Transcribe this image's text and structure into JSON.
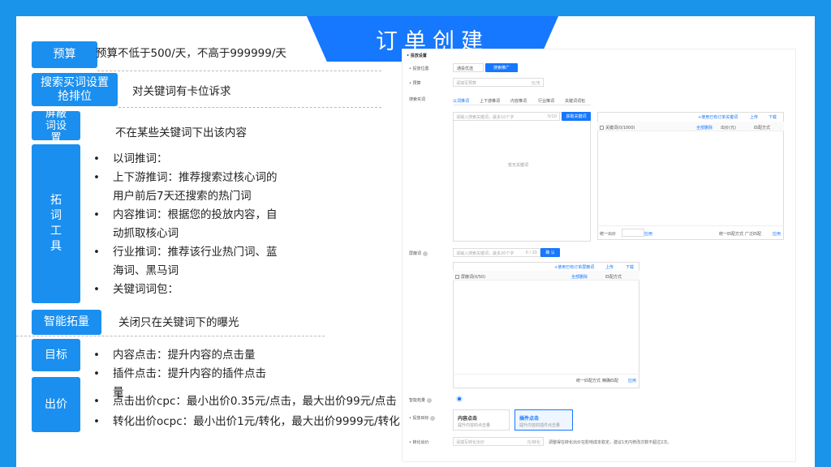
{
  "title": "订单创建",
  "rows": {
    "budget": {
      "label": "预算",
      "desc": "预算不低于500/天，不高于999999/天"
    },
    "bid_rank": {
      "label": "搜索买词设置抢排位",
      "desc": "对关键词有卡位诉求"
    },
    "block": {
      "label": "屏蔽词设置",
      "desc": "不在某些关键词下出该内容"
    },
    "expand_tool": {
      "label": "拓词工具",
      "items": [
        "以词推词：",
        "上下游推词：推荐搜索过核心词的用户前后7天还搜索的热门词",
        "内容推词：根据您的投放内容，自动抓取核心词",
        "行业推词：推荐该行业热门词、蓝海词、黑马词",
        "关键词词包："
      ]
    },
    "smart": {
      "label": "智能拓量",
      "desc": "关闭只在关键词下的曝光"
    },
    "target": {
      "label": "目标",
      "items": [
        "内容点击：提升内容的点击量",
        "插件点击：提升内容的插件点击量"
      ]
    },
    "bid": {
      "label": "出价",
      "items": [
        "点击出价cpc：最小出价0.35元/点击，最大出价99元/点击",
        "转化出价ocpc：最小出价1元/转化，最大出价9999元/转化"
      ]
    }
  },
  "screenshot": {
    "section_title": "• 投放设置",
    "placement_label": "• 投放位置",
    "placement_opt1": "通投优选",
    "placement_opt2": "搜索推广",
    "budget_label": "• 预算",
    "budget_placeholder": "请填写预算",
    "budget_unit": "元/天",
    "search_words_label": "搜索买词",
    "tabs": [
      "以词推词",
      "上下游推词",
      "内容推词",
      "行业推词",
      "关键词词包"
    ],
    "kw_input_placeholder": "请输入搜索关键词，最多10个字",
    "kw_count": "0/10",
    "get_kw_button": "获取关键词",
    "empty_text": "暂无关键词",
    "add_from_order": "+使用已有订单关键词",
    "upload": "上传",
    "download": "下载",
    "kw_header": "关键词(0/1000)",
    "delete_all": "全部删除",
    "bid_header": "出价(元)",
    "match_header": "匹配方式",
    "unified_bid": "统一出价",
    "apply": "应用",
    "unified_match": "统一匹配方式",
    "broad_match": "广泛匹配",
    "block_label": "屏蔽词",
    "block_placeholder": "请输入搜索关键词，最多20个字",
    "block_count": "0 / 20",
    "confirm": "确 认",
    "add_from_order2": "+使用已有订单屏蔽词",
    "block_header": "屏蔽词(0/50)",
    "exact_match": "精确匹配",
    "smart_label": "智能拓量",
    "goal_label": "• 投放目标",
    "goal1_title": "内容点击",
    "goal1_sub": "提升内容的点击量",
    "goal2_title": "插件点击",
    "goal2_sub": "提升内容的插件点击量",
    "conv_label": "• 转化出价",
    "conv_placeholder": "请填写转化出价",
    "conv_unit": "元/转化",
    "conv_note": "调整得在转化出价在影响成本稳定，建议1天内修改次数不超过2次。"
  }
}
